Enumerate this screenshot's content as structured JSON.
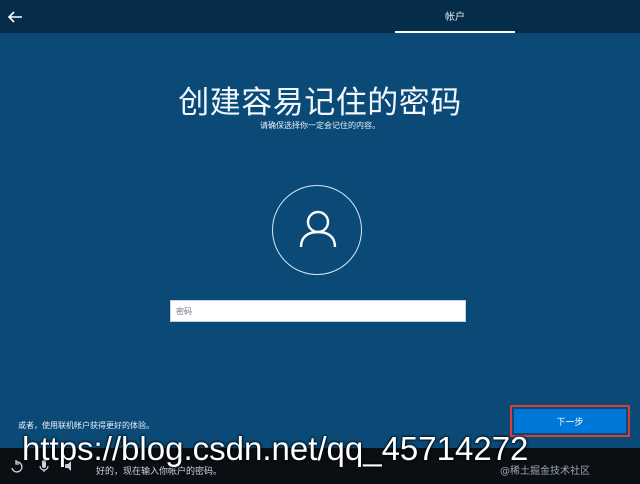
{
  "header": {
    "tab_label": "帐户"
  },
  "page": {
    "title": "创建容易记住的密码",
    "subtitle": "请确保选择你一定会记住的内容。"
  },
  "password": {
    "placeholder": "密码",
    "value": ""
  },
  "footer": {
    "online_account_text": "或者，使用联机帐户获得更好的体验。",
    "next_label": "下一步"
  },
  "taskbar": {
    "cortana_text": "好的，现在输入你帐户的密码。"
  },
  "overlay": {
    "url_watermark": "https://blog.csdn.net/qq_45714272",
    "credit_watermark": "@稀土掘金技术社区"
  },
  "colors": {
    "background": "#0b4a77",
    "topbar": "#052d4a",
    "accent_button": "#0078d7",
    "highlight_border": "#e03b3b"
  }
}
